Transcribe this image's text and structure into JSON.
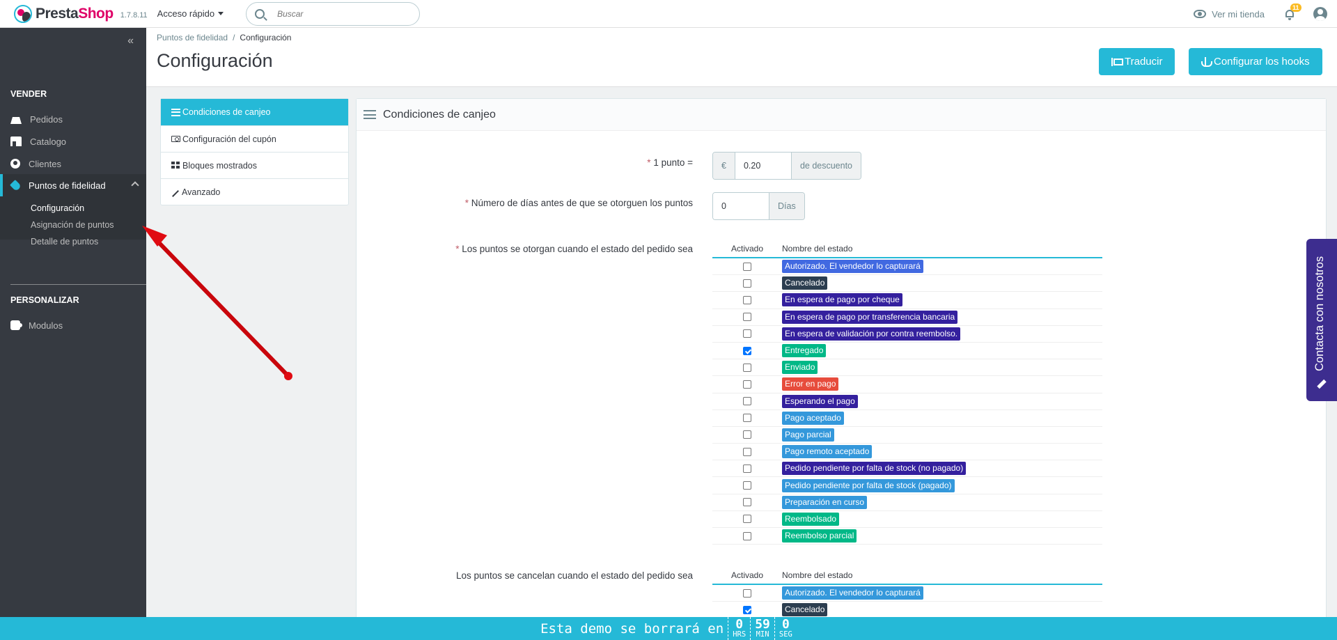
{
  "header": {
    "logo_text_1": "Presta",
    "logo_text_2": "Shop",
    "version": "1.7.8.11",
    "quick_access": "Acceso rápido",
    "search_placeholder": "Buscar",
    "view_store": "Ver mi tienda",
    "notifications_count": "11"
  },
  "sidebar": {
    "collapse_icon": "«",
    "section_sell": "VENDER",
    "items": [
      {
        "label": "Pedidos",
        "icon": "basket-icon"
      },
      {
        "label": "Catalogo",
        "icon": "store-icon"
      },
      {
        "label": "Clientes",
        "icon": "user-circle-icon"
      },
      {
        "label": "Puntos de fidelidad",
        "icon": "tag-icon"
      }
    ],
    "submenu": [
      "Configuración",
      "Asignación de puntos",
      "Detalle de puntos"
    ],
    "section_customize": "PERSONALIZAR",
    "modules": "Modulos"
  },
  "breadcrumb": {
    "parent": "Puntos de fidelidad",
    "sep": "/",
    "current": "Configuración"
  },
  "page_title": "Configuración",
  "toolbar": {
    "translate": "Traducir",
    "hooks": "Configurar los hooks"
  },
  "tabs": [
    {
      "label": "Condiciones de canjeo",
      "icon": "list-icon"
    },
    {
      "label": "Configuración del cupón",
      "icon": "money-icon"
    },
    {
      "label": "Bloques mostrados",
      "icon": "blocks-icon"
    },
    {
      "label": "Avanzado",
      "icon": "wand-icon"
    }
  ],
  "panel": {
    "title": "Condiciones de canjeo",
    "point_label": "1 punto =",
    "currency": "€",
    "point_value": "0.20",
    "discount_suffix": "de descuento",
    "days_label": "Número de días antes de que se otorguen los puntos",
    "days_value": "0",
    "days_suffix": "Días",
    "awarded_label": "Los puntos se otorgan cuando el estado del pedido sea",
    "cancelled_label": "Los puntos se cancelan cuando el estado del pedido sea",
    "col_enabled": "Activado",
    "col_status": "Nombre del estado",
    "required_mark": "*"
  },
  "statuses_awarded": [
    {
      "name": "Autorizado. El vendedor lo capturará",
      "color": "#4169e1",
      "checked": false
    },
    {
      "name": "Cancelado",
      "color": "#2c3e50",
      "checked": false
    },
    {
      "name": "En espera de pago por cheque",
      "color": "#34209e",
      "checked": false
    },
    {
      "name": "En espera de pago por transferencia bancaria",
      "color": "#34209e",
      "checked": false
    },
    {
      "name": "En espera de validación por contra reembolso.",
      "color": "#34209e",
      "checked": false
    },
    {
      "name": "Entregado",
      "color": "#01b887",
      "checked": true
    },
    {
      "name": "Enviado",
      "color": "#01b887",
      "checked": false
    },
    {
      "name": "Error en pago",
      "color": "#e74c3c",
      "checked": false
    },
    {
      "name": "Esperando el pago",
      "color": "#34209e",
      "checked": false
    },
    {
      "name": "Pago aceptado",
      "color": "#3498db",
      "checked": false
    },
    {
      "name": "Pago parcial",
      "color": "#3498db",
      "checked": false
    },
    {
      "name": "Pago remoto aceptado",
      "color": "#3498db",
      "checked": false
    },
    {
      "name": "Pedido pendiente por falta de stock (no pagado)",
      "color": "#34209e",
      "checked": false
    },
    {
      "name": "Pedido pendiente por falta de stock (pagado)",
      "color": "#3498db",
      "checked": false
    },
    {
      "name": "Preparación en curso",
      "color": "#3498db",
      "checked": false
    },
    {
      "name": "Reembolsado",
      "color": "#01b887",
      "checked": false
    },
    {
      "name": "Reembolso parcial",
      "color": "#01b887",
      "checked": false
    }
  ],
  "statuses_cancelled": [
    {
      "name": "Autorizado. El vendedor lo capturará",
      "color": "#3498db",
      "checked": false
    },
    {
      "name": "Cancelado",
      "color": "#2c3e50",
      "checked": true
    }
  ],
  "contact": {
    "label": "Contacta con nosotros"
  },
  "banner": {
    "text": "Esta demo se borrará en",
    "hours": "0",
    "hours_unit": "HRS",
    "minutes": "59",
    "minutes_unit": "MIN",
    "seconds": "0",
    "seconds_unit": "SEG"
  }
}
